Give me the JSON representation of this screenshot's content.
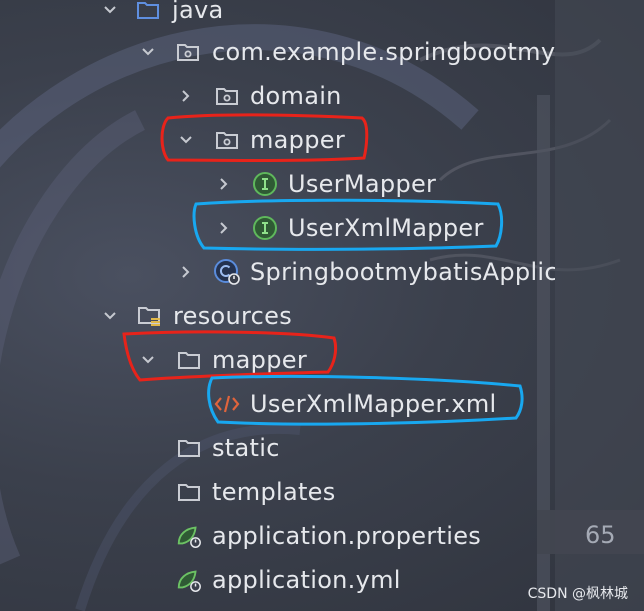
{
  "tree": {
    "items": [
      {
        "label": "java",
        "icon": "source-folder-icon"
      },
      {
        "label": "com.example.springbootmy",
        "icon": "package-icon"
      },
      {
        "label": "domain",
        "icon": "package-icon"
      },
      {
        "label": "mapper",
        "icon": "package-icon"
      },
      {
        "label": "UserMapper",
        "icon": "interface-icon"
      },
      {
        "label": "UserXmlMapper",
        "icon": "interface-icon"
      },
      {
        "label": "SpringbootmybatisApplic",
        "icon": "spring-boot-class-icon"
      },
      {
        "label": "resources",
        "icon": "resources-folder-icon"
      },
      {
        "label": "mapper",
        "icon": "folder-icon"
      },
      {
        "label": "UserXmlMapper.xml",
        "icon": "xml-file-icon"
      },
      {
        "label": "static",
        "icon": "folder-icon"
      },
      {
        "label": "templates",
        "icon": "folder-icon"
      },
      {
        "label": "application.properties",
        "icon": "properties-file-icon"
      },
      {
        "label": "application.yml",
        "icon": "yaml-file-icon"
      }
    ]
  },
  "gutter": {
    "line_65": "65"
  },
  "watermark": "CSDN @枫林城",
  "colors": {
    "text": "#e6e8ec",
    "interface_icon": "#5fb85c",
    "spring_icon": "#5a8cdc",
    "xml_icon": "#e0643c",
    "red_annotation": "#e8231a",
    "blue_annotation": "#18a8f0"
  }
}
